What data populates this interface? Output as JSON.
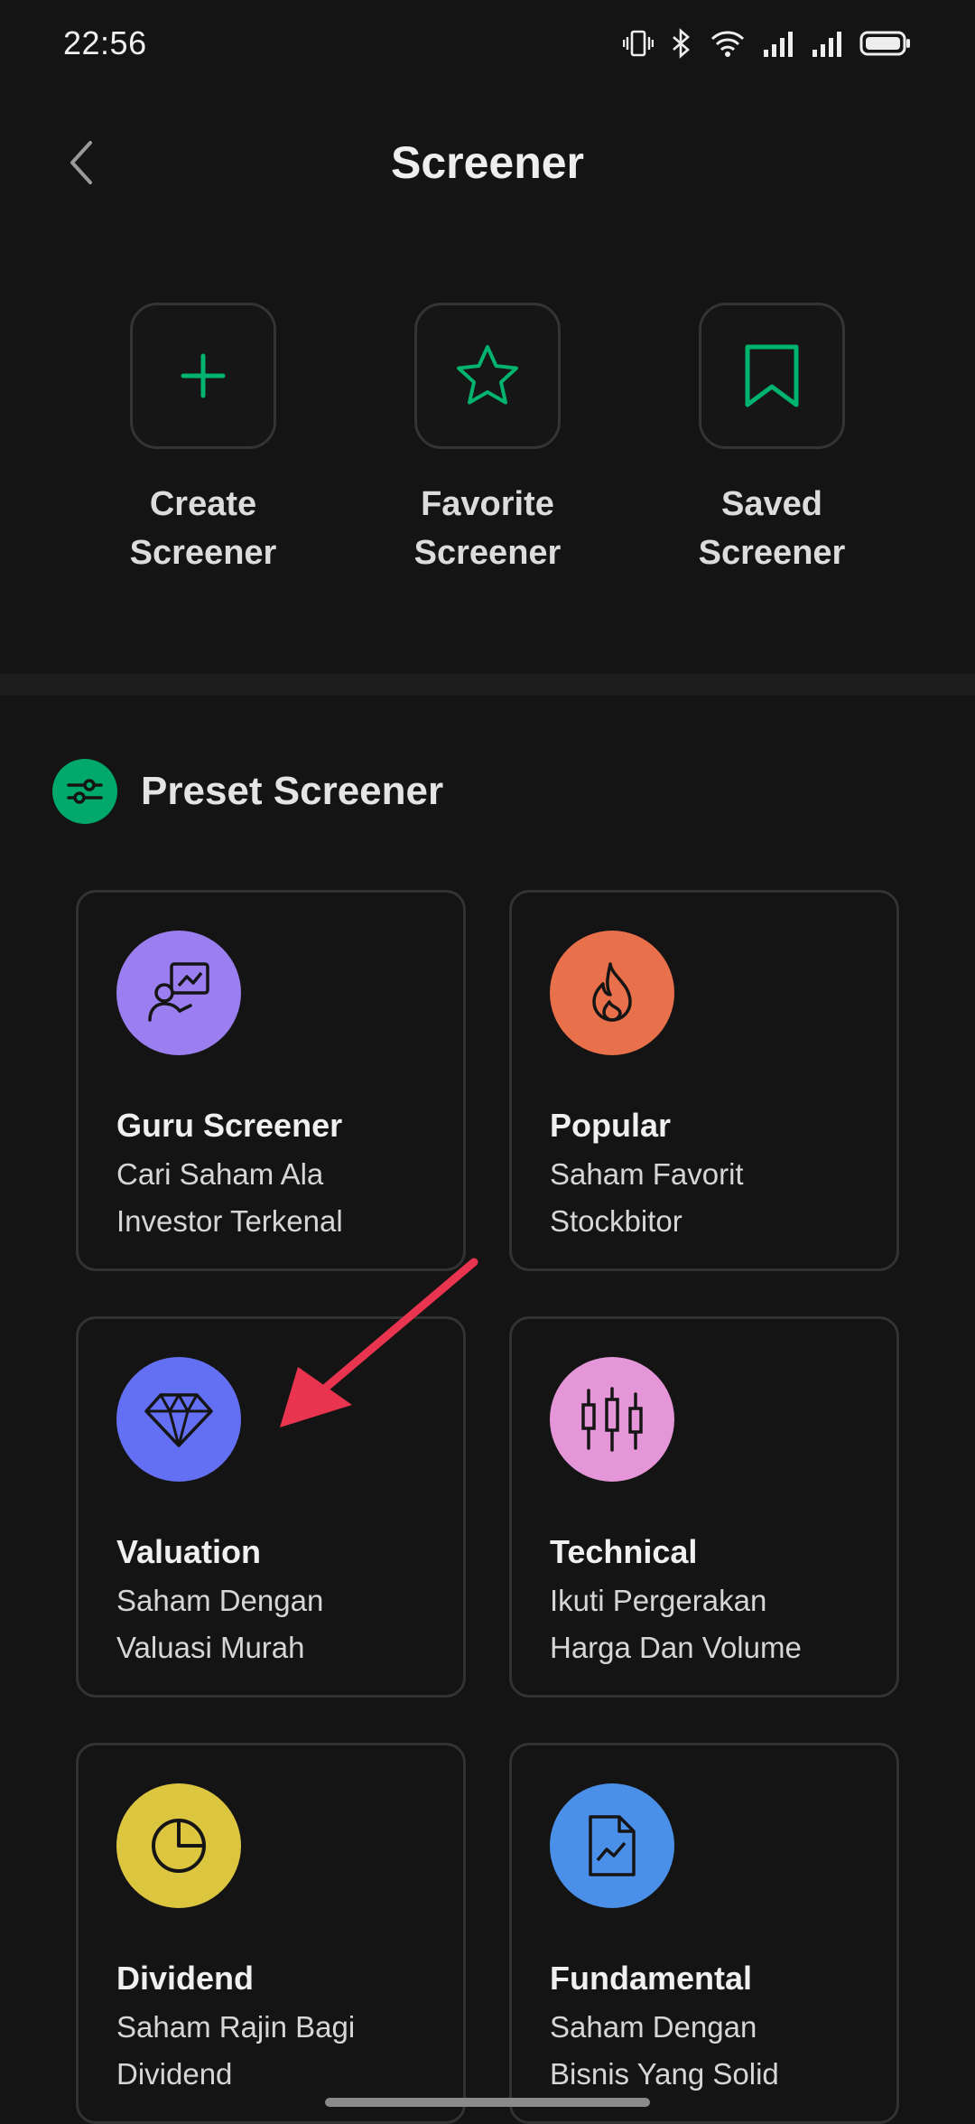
{
  "status_bar": {
    "time": "22:56"
  },
  "header": {
    "title": "Screener"
  },
  "quick_actions": [
    {
      "label": "Create\nScreener",
      "icon": "plus-icon"
    },
    {
      "label": "Favorite\nScreener",
      "icon": "star-icon"
    },
    {
      "label": "Saved\nScreener",
      "icon": "bookmark-icon"
    }
  ],
  "preset": {
    "title": "Preset Screener",
    "cards": [
      {
        "title": "Guru Screener",
        "desc": "Cari Saham Ala\nInvestor Terkenal",
        "icon": "presenter-chart-icon",
        "color": "#9b7ff0"
      },
      {
        "title": "Popular",
        "desc": "Saham Favorit\nStockbitor",
        "icon": "flame-icon",
        "color": "#e8704a"
      },
      {
        "title": "Valuation",
        "desc": "Saham Dengan\nValuasi Murah",
        "icon": "diamond-icon",
        "color": "#6470f4"
      },
      {
        "title": "Technical",
        "desc": "Ikuti Pergerakan\nHarga Dan Volume",
        "icon": "candlestick-icon",
        "color": "#e596d8"
      },
      {
        "title": "Dividend",
        "desc": "Saham Rajin Bagi\nDividend",
        "icon": "pie-chart-icon",
        "color": "#dcc640"
      },
      {
        "title": "Fundamental",
        "desc": "Saham Dengan\nBisnis Yang Solid",
        "icon": "document-chart-icon",
        "color": "#4a8fe8"
      }
    ]
  },
  "colors": {
    "accent": "#00a86b",
    "background": "#141414",
    "annotation_arrow": "#e8344e"
  }
}
